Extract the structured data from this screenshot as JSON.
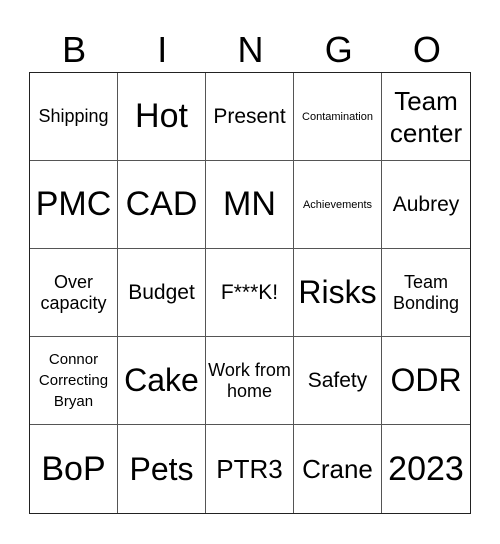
{
  "header": [
    "B",
    "I",
    "N",
    "G",
    "O"
  ],
  "cells": [
    "Shipping",
    "Hot",
    "Present",
    "Contamination",
    "Team center",
    "PMC",
    "CAD",
    "MN",
    "Achievements",
    "Aubrey",
    "Over capacity",
    "Budget",
    "F***K!",
    "Risks",
    "Team Bonding",
    "Connor Correcting Bryan",
    "Cake",
    "Work from home",
    "Safety",
    "ODR",
    "BoP",
    "Pets",
    "PTR3",
    "Crane",
    "2023"
  ]
}
